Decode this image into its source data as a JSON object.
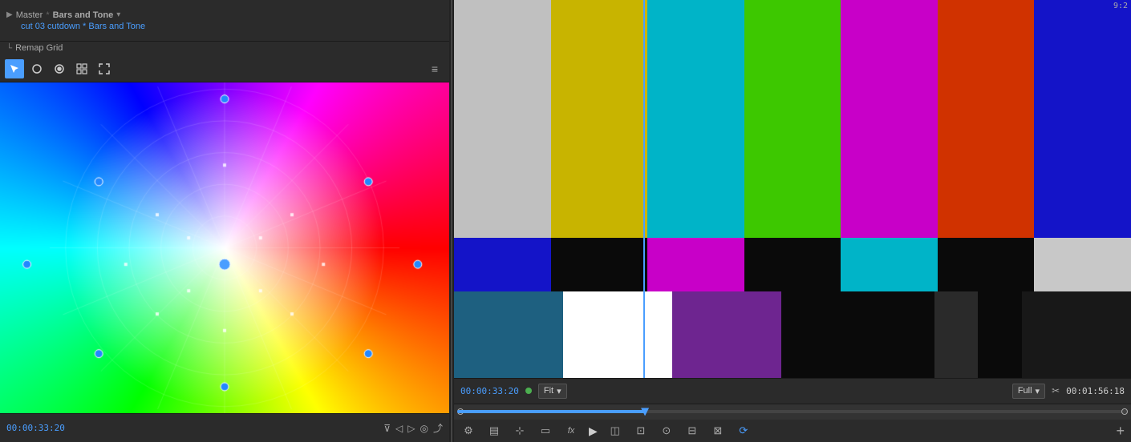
{
  "header": {
    "breadcrumb": {
      "master": "Master",
      "separator1": "*",
      "title": "Bars and Tone",
      "arrow": "›",
      "cut": "cut 03 cutdown * Bars and Tone",
      "remap": "Remap Grid"
    },
    "title_badge": "9:2"
  },
  "toolbar": {
    "tools": [
      {
        "id": "select",
        "icon": "✦",
        "active": true,
        "label": "Select"
      },
      {
        "id": "circle",
        "icon": "◎",
        "active": false,
        "label": "Circle"
      },
      {
        "id": "point",
        "icon": "◉",
        "active": false,
        "label": "Point"
      },
      {
        "id": "grid",
        "icon": "⊞",
        "active": false,
        "label": "Grid"
      },
      {
        "id": "expand",
        "icon": "⤡",
        "active": false,
        "label": "Expand"
      }
    ],
    "menu_icon": "≡"
  },
  "playback": {
    "timecode_left": "00:00:33:20",
    "fit_label": "Fit",
    "quality_label": "Full",
    "timecode_right": "00:01:56:18"
  },
  "smpte_bars": {
    "top_bars": [
      {
        "color": "#c0c0c0",
        "label": "gray"
      },
      {
        "color": "#c8b400",
        "label": "yellow"
      },
      {
        "color": "#00b4c8",
        "label": "cyan"
      },
      {
        "color": "#00b400",
        "label": "green"
      },
      {
        "color": "#b400b4",
        "label": "magenta"
      },
      {
        "color": "#c83200",
        "label": "red"
      },
      {
        "color": "#1414c8",
        "label": "blue"
      }
    ],
    "middle_bars": [
      {
        "color": "#1414c8",
        "label": "blue"
      },
      {
        "color": "#111111",
        "label": "black"
      },
      {
        "color": "#b400b4",
        "label": "magenta"
      },
      {
        "color": "#111111",
        "label": "black"
      },
      {
        "color": "#00b4c8",
        "label": "cyan"
      },
      {
        "color": "#111111",
        "label": "black"
      },
      {
        "color": "#c0c0c0",
        "label": "gray"
      }
    ],
    "bottom_bars": [
      {
        "color": "#1e6080",
        "label": "dark-cyan",
        "flex": 1
      },
      {
        "color": "#ffffff",
        "label": "white",
        "flex": 1
      },
      {
        "color": "#6e2590",
        "label": "purple",
        "flex": 1
      },
      {
        "color": "#111111",
        "label": "black",
        "flex": 1
      },
      {
        "color": "#111111",
        "label": "black2",
        "flex": 0.3
      },
      {
        "color": "#333333",
        "label": "dark-gray",
        "flex": 0.3
      },
      {
        "color": "#111111",
        "label": "black3",
        "flex": 0.3
      },
      {
        "color": "#222222",
        "label": "near-black",
        "flex": 1
      }
    ]
  },
  "bottom_toolbar_icons": [
    {
      "id": "settings",
      "icon": "⚙",
      "label": "settings-icon"
    },
    {
      "id": "edit",
      "icon": "▤",
      "label": "edit-icon"
    },
    {
      "id": "snap",
      "icon": "⊹",
      "label": "snap-icon"
    },
    {
      "id": "mask",
      "icon": "▭",
      "label": "mask-icon"
    },
    {
      "id": "fx",
      "icon": "fx",
      "label": "fx-icon"
    },
    {
      "id": "play",
      "icon": "▶",
      "label": "play-icon"
    },
    {
      "id": "trim",
      "icon": "◫",
      "label": "trim-icon"
    },
    {
      "id": "slip",
      "icon": "⊡",
      "label": "slip-icon"
    },
    {
      "id": "camera",
      "icon": "⊙",
      "label": "camera-icon"
    },
    {
      "id": "multicam",
      "icon": "⊟",
      "label": "multicam-icon"
    },
    {
      "id": "layout",
      "icon": "⊠",
      "label": "layout-icon"
    },
    {
      "id": "motion",
      "icon": "⟳",
      "label": "motion-icon"
    },
    {
      "id": "add",
      "icon": "+",
      "label": "add-icon"
    }
  ]
}
